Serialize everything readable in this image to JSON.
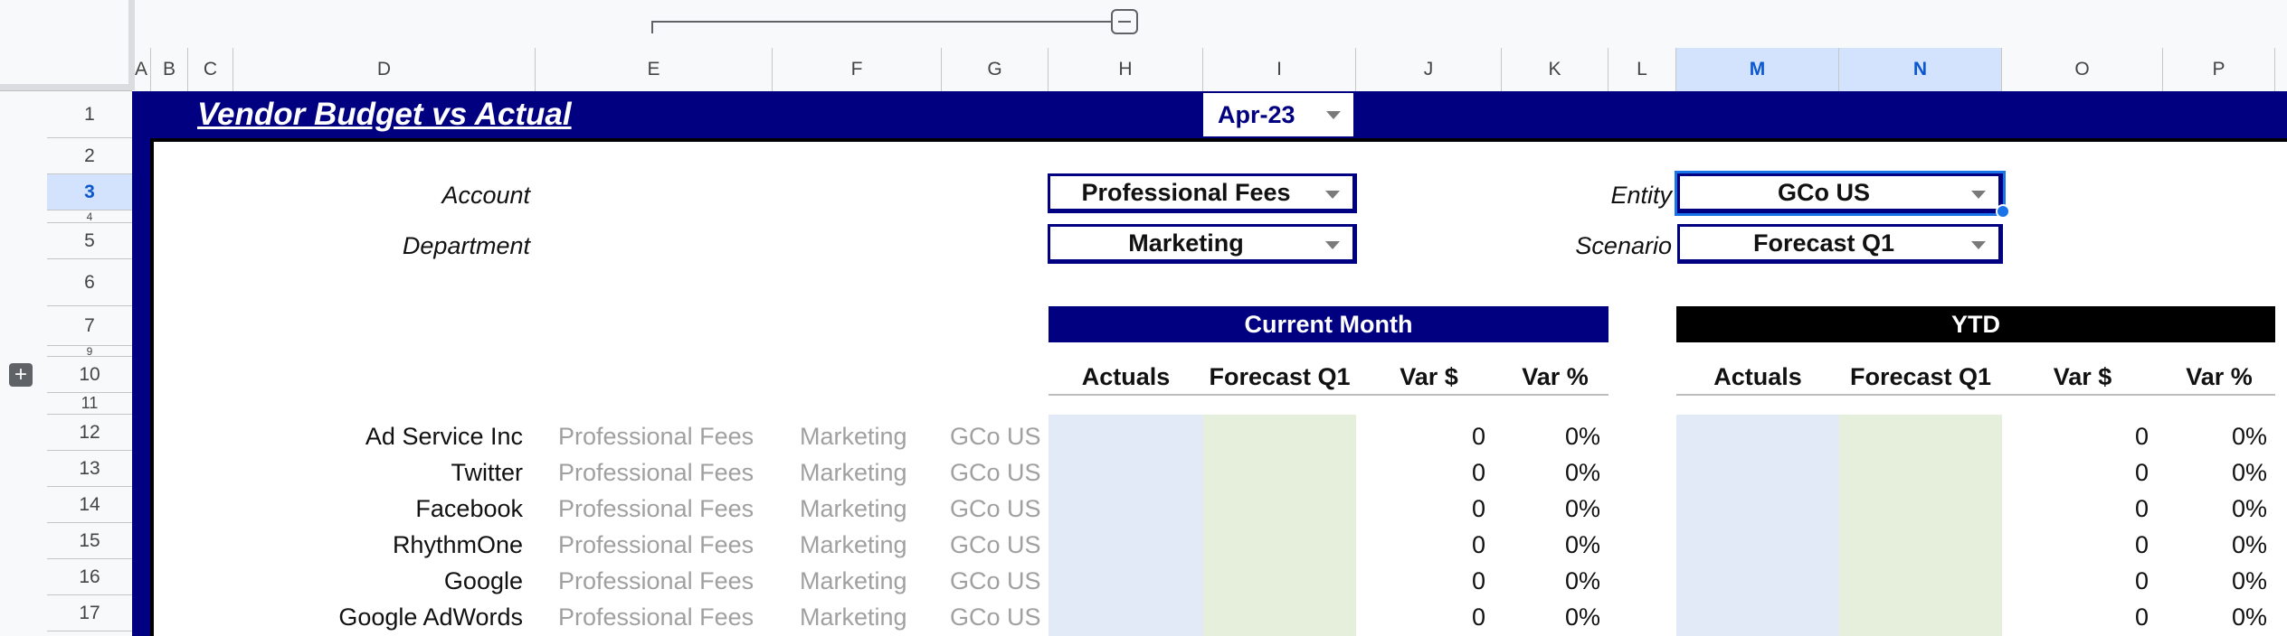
{
  "columns": [
    "A",
    "B",
    "C",
    "D",
    "E",
    "F",
    "G",
    "H",
    "I",
    "J",
    "K",
    "L",
    "M",
    "N",
    "O",
    "P"
  ],
  "rows": [
    "1",
    "2",
    "3",
    "4",
    "5",
    "6",
    "7",
    "9",
    "10",
    "11",
    "12",
    "13",
    "14",
    "15",
    "16",
    "17"
  ],
  "sheet": {
    "title": "Vendor Budget vs Actual",
    "month": "Apr-23",
    "filters": {
      "account_label": "Account",
      "account_value": "Professional Fees",
      "department_label": "Department",
      "department_value": "Marketing",
      "entity_label": "Entity",
      "entity_value": "GCo US",
      "scenario_label": "Scenario",
      "scenario_value": "Forecast Q1"
    },
    "current_month": {
      "title": "Current Month",
      "headers": [
        "Actuals",
        "Forecast Q1",
        "Var $",
        "Var %"
      ]
    },
    "ytd": {
      "title": "YTD",
      "headers": [
        "Actuals",
        "Forecast Q1",
        "Var $",
        "Var %"
      ]
    },
    "vendors": [
      {
        "name": "Ad Service Inc",
        "account": "Professional Fees",
        "dept": "Marketing",
        "entity": "GCo US",
        "var": "0",
        "pct": "0%",
        "ytd_var": "0",
        "ytd_pct": "0%"
      },
      {
        "name": "Twitter",
        "account": "Professional Fees",
        "dept": "Marketing",
        "entity": "GCo US",
        "var": "0",
        "pct": "0%",
        "ytd_var": "0",
        "ytd_pct": "0%"
      },
      {
        "name": "Facebook",
        "account": "Professional Fees",
        "dept": "Marketing",
        "entity": "GCo US",
        "var": "0",
        "pct": "0%",
        "ytd_var": "0",
        "ytd_pct": "0%"
      },
      {
        "name": "RhythmOne",
        "account": "Professional Fees",
        "dept": "Marketing",
        "entity": "GCo US",
        "var": "0",
        "pct": "0%",
        "ytd_var": "0",
        "ytd_pct": "0%"
      },
      {
        "name": "Google",
        "account": "Professional Fees",
        "dept": "Marketing",
        "entity": "GCo US",
        "var": "0",
        "pct": "0%",
        "ytd_var": "0",
        "ytd_pct": "0%"
      },
      {
        "name": "Google AdWords",
        "account": "Professional Fees",
        "dept": "Marketing",
        "entity": "GCo US",
        "var": "0",
        "pct": "0%",
        "ytd_var": "0",
        "ytd_pct": "0%"
      }
    ]
  },
  "colors": {
    "navy": "#000080",
    "black": "#000000",
    "actuals_fill": "#e3eaf7",
    "forecast_fill": "#e6efdb",
    "selection": "#1a73e8"
  },
  "icons": {
    "collapse": "minus-icon",
    "expand": "plus-icon",
    "dropdown": "caret-down-icon"
  }
}
